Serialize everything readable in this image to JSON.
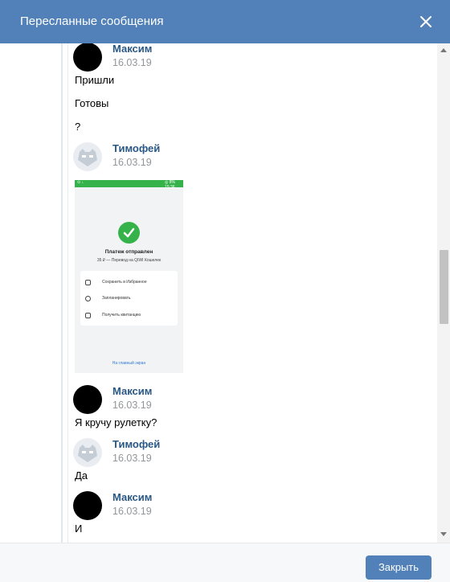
{
  "dialog": {
    "title": "Пересланные сообщения",
    "close_icon": "close-icon",
    "header_color": "#5181b8"
  },
  "messages": [
    {
      "author": "Максим",
      "date": "16.03.19",
      "lines": [
        "Пришли",
        "Готовы",
        "?"
      ]
    },
    {
      "author": "Тимофей",
      "date": "16.03.19",
      "attachment": {
        "type": "photo",
        "status_left": "⊙ ↓",
        "status_right": "◎ 8% 15:36",
        "title": "Платеж отправлен",
        "subtitle": "35 ₽ — Перевод на QIWI Кошелек",
        "actions": [
          "Сохранить в Избранное",
          "Запланировать",
          "Получить квитанцию"
        ],
        "link": "На главный экран"
      }
    },
    {
      "author": "Максим",
      "date": "16.03.19",
      "lines": [
        "Я кручу рулетку?"
      ]
    },
    {
      "author": "Тимофей",
      "date": "16.03.19",
      "lines": [
        "Да"
      ]
    },
    {
      "author": "Максим",
      "date": "16.03.19",
      "lines": [
        "И"
      ]
    }
  ],
  "footer": {
    "close_label": "Закрыть"
  },
  "colors": {
    "accent": "#5181b8",
    "author": "#2a5885",
    "date": "#939699",
    "success": "#35b34a"
  }
}
